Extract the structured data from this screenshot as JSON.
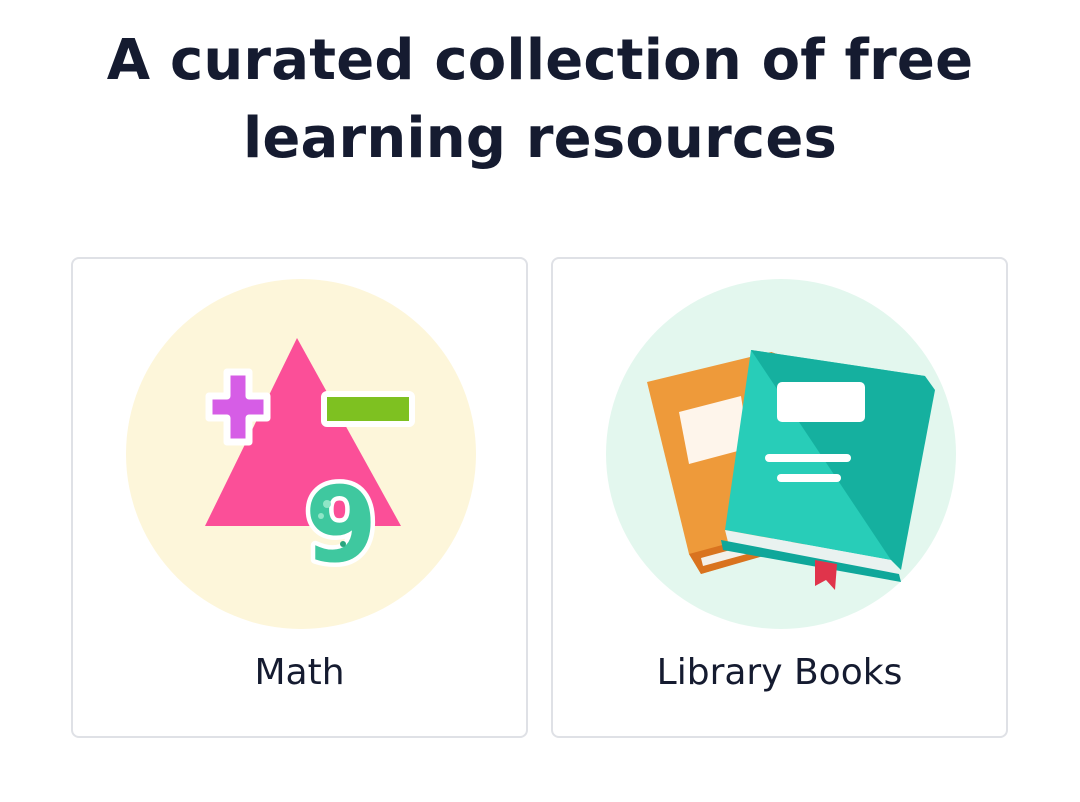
{
  "header": {
    "title_line1": "A curated collection of free",
    "title_line2": "learning resources"
  },
  "cards": [
    {
      "label": "Math",
      "icon": "math-symbols-icon",
      "accent_bg": "#fdf6da"
    },
    {
      "label": "Library Books",
      "icon": "books-icon",
      "accent_bg": "#e3f7ee"
    }
  ],
  "math_icon": {
    "digit": "9"
  }
}
